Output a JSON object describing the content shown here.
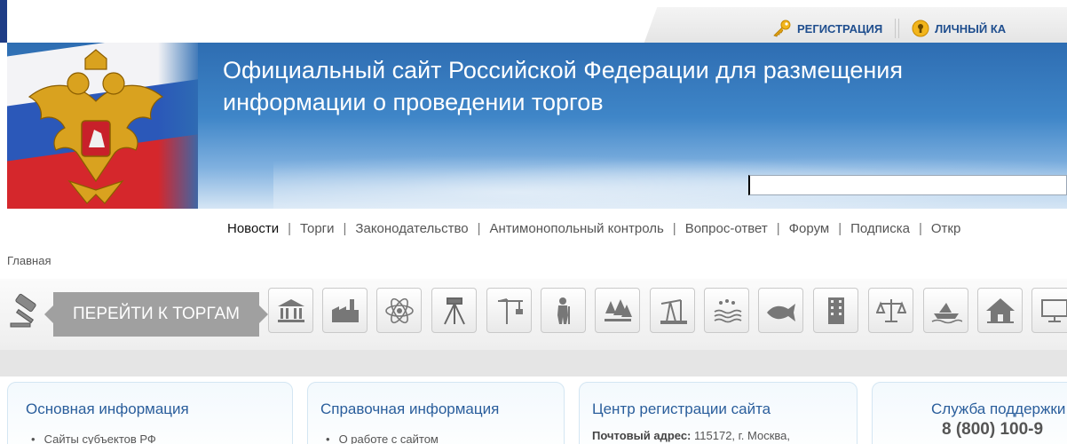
{
  "topbar": {
    "register_label": "РЕГИСТРАЦИЯ",
    "cabinet_label": "ЛИЧНЫЙ КА"
  },
  "header": {
    "title_line1": "Официальный сайт Российской Федерации для размещения",
    "title_line2": "информации о проведении торгов",
    "search_value": ""
  },
  "nav": {
    "items": [
      {
        "label": "Новости"
      },
      {
        "label": "Торги"
      },
      {
        "label": "Законодательство"
      },
      {
        "label": "Антимонопольный контроль"
      },
      {
        "label": "Вопрос-ответ"
      },
      {
        "label": "Форум"
      },
      {
        "label": "Подписка"
      },
      {
        "label": "Откр"
      }
    ]
  },
  "breadcrumb": {
    "home": "Главная"
  },
  "categories": {
    "goto_label": "ПЕРЕЙТИ К ТОРГАМ",
    "icons": [
      "gavel-icon",
      "bank-building-icon",
      "factory-icon",
      "atom-icon",
      "geodetic-tripod-icon",
      "crane-icon",
      "worker-icon",
      "forest-icon",
      "oil-pump-icon",
      "water-icon",
      "fish-icon",
      "office-building-icon",
      "scales-icon",
      "boat-icon",
      "house-icon",
      "monitor-icon"
    ]
  },
  "panels": {
    "main_info": {
      "title": "Основная информация",
      "items": [
        "Сайты субъектов РФ"
      ]
    },
    "reference": {
      "title": "Справочная информация",
      "items": [
        "О работе с сайтом"
      ]
    },
    "registration_center": {
      "title": "Центр регистрации сайта",
      "addr_label": "Почтовый адрес:",
      "addr_value": "115172, г. Москва,"
    },
    "support": {
      "title": "Служба поддержки",
      "phone": "8 (800) 100-9"
    }
  },
  "colors": {
    "link_blue": "#1f4e8e",
    "banner_blue": "#2e6db2",
    "panel_title": "#2a5e9c",
    "goto_button": "#a0a0a0"
  }
}
